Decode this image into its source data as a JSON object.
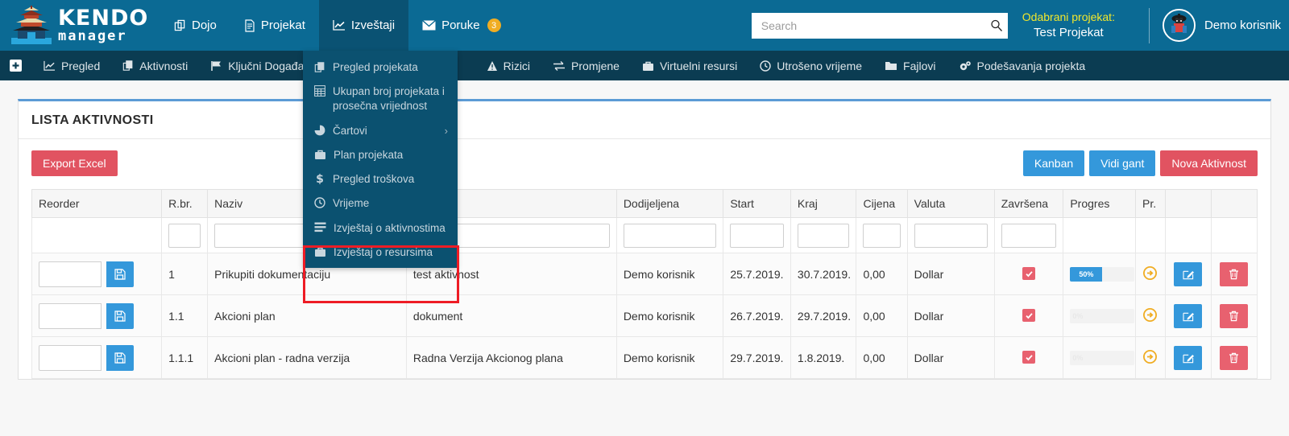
{
  "brand": {
    "kendo": "KENDO",
    "manager": "manager",
    "logo_icon": "pagoda-logo-icon"
  },
  "topnav": {
    "items": [
      {
        "label": "Dojo",
        "icon": "copy-icon",
        "active": false
      },
      {
        "label": "Projekat",
        "icon": "file-text-icon",
        "active": false
      },
      {
        "label": "Izveštaji",
        "icon": "chart-line-icon",
        "active": true
      },
      {
        "label": "Poruke",
        "icon": "envelope-icon",
        "active": false,
        "badge": "3"
      }
    ]
  },
  "search": {
    "placeholder": "Search",
    "value": "",
    "icon": "search-icon"
  },
  "selected_project": {
    "label": "Odabrani projekat:",
    "value": "Test Projekat"
  },
  "user": {
    "name": "Demo korisnik",
    "avatar_icon": "samurai-avatar-icon"
  },
  "subnav": {
    "items": [
      {
        "label": "",
        "icon": "plus-square-icon"
      },
      {
        "label": "Pregled",
        "icon": "chart-line-icon"
      },
      {
        "label": "Aktivnosti",
        "icon": "copy-icon"
      },
      {
        "label": "Ključni Događaji",
        "icon": "flag-icon"
      },
      {
        "label": "",
        "icon": "hidden-item"
      },
      {
        "label": "Rizici",
        "icon": "warning-triangle-icon"
      },
      {
        "label": "Promjene",
        "icon": "exchange-icon"
      },
      {
        "label": "Virtuelni resursi",
        "icon": "briefcase-icon"
      },
      {
        "label": "Utrošeno vrijeme",
        "icon": "clock-icon"
      },
      {
        "label": "Fajlovi",
        "icon": "folder-icon"
      },
      {
        "label": "Podešavanja projekta",
        "icon": "gears-icon"
      }
    ]
  },
  "dropdown": {
    "items": [
      {
        "label": "Pregled projekata",
        "icon": "copy-icon",
        "submenu": false,
        "highlighted": false
      },
      {
        "label": "Ukupan broj projekata i prosečna vrijednost",
        "icon": "table-icon",
        "submenu": false,
        "highlighted": false
      },
      {
        "label": "Čartovi",
        "icon": "pie-chart-icon",
        "submenu": true,
        "highlighted": false
      },
      {
        "label": "Plan projekata",
        "icon": "briefcase-icon",
        "submenu": false,
        "highlighted": false
      },
      {
        "label": "Pregled troškova",
        "icon": "dollar-icon",
        "submenu": false,
        "highlighted": false
      },
      {
        "label": "Vrijeme",
        "icon": "clock-icon",
        "submenu": false,
        "highlighted": false
      },
      {
        "label": "Izvještaj o aktivnostima",
        "icon": "list-icon",
        "submenu": false,
        "highlighted": true
      },
      {
        "label": "Izvještaj o resursima",
        "icon": "briefcase-icon",
        "submenu": false,
        "highlighted": true
      }
    ],
    "submenu_caret": "›",
    "highlight_color": "#ee1c25"
  },
  "panel": {
    "title": "LISTA AKTIVNOSTI"
  },
  "toolbar": {
    "export_label": "Export Excel",
    "kanban_label": "Kanban",
    "gantt_label": "Vidi gant",
    "new_activity_label": "Nova Aktivnost"
  },
  "table": {
    "headers": [
      "Reorder",
      "R.br.",
      "Naziv",
      "",
      "Dodijeljena",
      "Start",
      "Kraj",
      "Cijena",
      "Valuta",
      "Završena",
      "Progres",
      "Pr.",
      "",
      ""
    ],
    "filters": [
      "",
      "",
      "",
      "",
      "",
      "",
      "",
      "",
      "",
      "",
      "",
      "",
      "",
      ""
    ],
    "rows": [
      {
        "reorder": "",
        "rbr": "1",
        "naziv": "Prikupiti dokumentaciju",
        "opis": "test aktivnost",
        "dodijeljena": "Demo korisnik",
        "start": "25.7.2019.",
        "kraj": "30.7.2019.",
        "cijena": "0,00",
        "valuta": "Dollar",
        "zavrsena": true,
        "progres": 50,
        "progres_label": "50%"
      },
      {
        "reorder": "",
        "rbr": "1.1",
        "naziv": "Akcioni plan",
        "opis": "dokument",
        "dodijeljena": "Demo korisnik",
        "start": "26.7.2019.",
        "kraj": "29.7.2019.",
        "cijena": "0,00",
        "valuta": "Dollar",
        "zavrsena": true,
        "progres": 0,
        "progres_label": "0%"
      },
      {
        "reorder": "",
        "rbr": "1.1.1",
        "naziv": "Akcioni plan - radna verzija",
        "opis": "Radna Verzija Akcionog plana",
        "dodijeljena": "Demo korisnik",
        "start": "29.7.2019.",
        "kraj": "1.8.2019.",
        "cijena": "0,00",
        "valuta": "Dollar",
        "zavrsena": true,
        "progres": 0,
        "progres_label": "0%"
      }
    ],
    "row_icons": {
      "save": "save-disk-icon",
      "promote": "arrow-circle-right-icon",
      "edit": "edit-pencil-icon",
      "delete": "trash-icon"
    }
  },
  "colors": {
    "header_blue": "#0b6a94",
    "subnav_blue": "#0b3c52",
    "dropdown_blue": "#0b5170",
    "accent_red": "#e15361",
    "accent_blue": "#3498db",
    "badge_yellow": "#f0ad23",
    "label_yellow": "#f2e72c",
    "highlight_red": "#ee1c25"
  }
}
